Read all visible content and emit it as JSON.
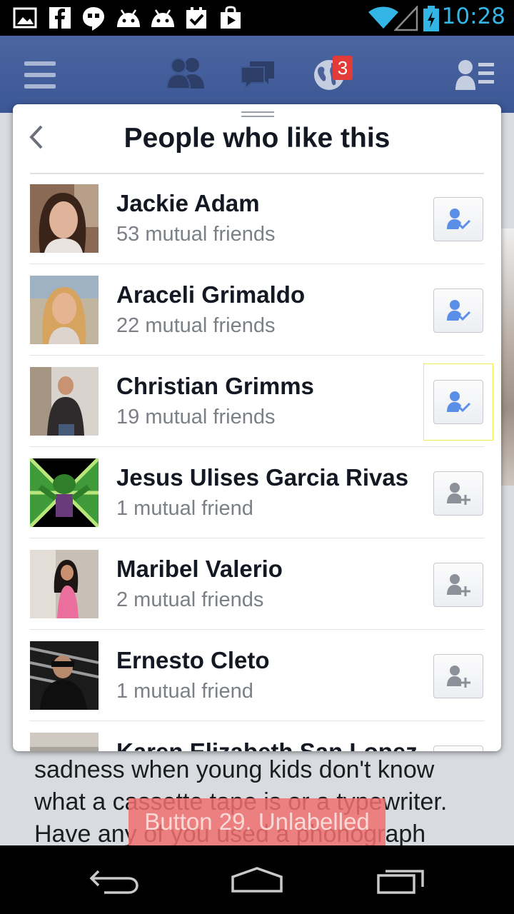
{
  "status_bar": {
    "time": "10:28"
  },
  "top_bar": {
    "notification_count": "3"
  },
  "dialog": {
    "title": "People who like this",
    "people": [
      {
        "name": "Jackie Adam",
        "mutual": "53 mutual friends",
        "status": "friends"
      },
      {
        "name": "Araceli Grimaldo",
        "mutual": "22 mutual friends",
        "status": "friends"
      },
      {
        "name": "Christian Grimms",
        "mutual": "19 mutual friends",
        "status": "friends"
      },
      {
        "name": "Jesus Ulises Garcia Rivas",
        "mutual": "1 mutual friend",
        "status": "add"
      },
      {
        "name": "Maribel Valerio",
        "mutual": "2 mutual friends",
        "status": "add"
      },
      {
        "name": "Ernesto Cleto",
        "mutual": "1 mutual friend",
        "status": "add"
      },
      {
        "name": "Karen Elizabeth San Lopez",
        "mutual": "",
        "status": "add"
      }
    ]
  },
  "feed": {
    "post_text": "sadness when young kids don't know what a cassette tape is or a typewriter. Have any of you used a phonograph"
  },
  "accessibility_overlay": {
    "label": "Button 29. Unlabelled"
  },
  "colors": {
    "fb_blue": "#3b5795",
    "status_time": "#33b5e5",
    "friend_icon": "#5b8ee6",
    "badge": "#e33a3a"
  }
}
